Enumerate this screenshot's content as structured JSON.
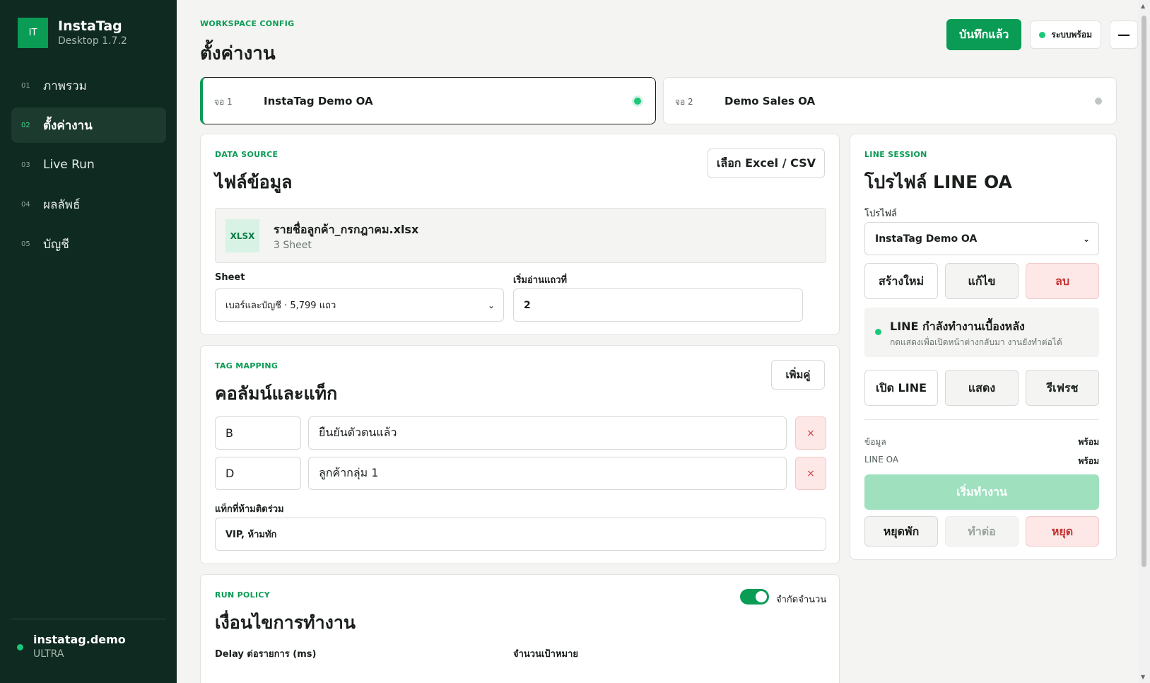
{
  "app": {
    "logo": "IT",
    "name": "InstaTag",
    "version": "Desktop 1.7.2"
  },
  "nav": [
    {
      "num": "01",
      "label": "ภาพรวม"
    },
    {
      "num": "02",
      "label": "ตั้งค่างาน"
    },
    {
      "num": "03",
      "label": "Live Run"
    },
    {
      "num": "04",
      "label": "ผลลัพธ์"
    },
    {
      "num": "05",
      "label": "บัญชี"
    }
  ],
  "user": {
    "name": "instatag.demo",
    "plan": "ULTRA"
  },
  "header": {
    "kicker": "WORKSPACE CONFIG",
    "title": "ตั้งค่างาน",
    "saved_label": "บันทึกแล้ว",
    "status_label": "ระบบพร้อม",
    "minimize_label": "—"
  },
  "screens": [
    {
      "num": "จอ 1",
      "name": "InstaTag Demo OA"
    },
    {
      "num": "จอ 2",
      "name": "Demo Sales OA"
    }
  ],
  "data_source": {
    "kicker": "DATA SOURCE",
    "title": "ไฟล์ข้อมูล",
    "choose_label": "เลือก Excel / CSV",
    "file_badge": "XLSX",
    "file_name": "รายชื่อลูกค้า_กรกฎาคม.xlsx",
    "file_meta": "3 Sheet",
    "sheet_label": "Sheet",
    "sheet_value": "เบอร์และบัญชี · 5,799 แถว",
    "start_row_label": "เริ่มอ่านแถวที่",
    "start_row_value": "2"
  },
  "tag_mapping": {
    "kicker": "TAG MAPPING",
    "title": "คอลัมน์และแท็ก",
    "add_label": "เพิ่มคู่",
    "rows": [
      {
        "column": "B",
        "tag": "ยืนยันตัวตนแล้ว"
      },
      {
        "column": "D",
        "tag": "ลูกค้ากลุ่ม 1"
      }
    ],
    "delete_glyph": "×",
    "excluded_label": "แท็กที่ห้ามติดร่วม",
    "excluded_value": "VIP, ห้ามทัก"
  },
  "run_policy": {
    "kicker": "RUN POLICY",
    "title": "เงื่อนไขการทำงาน",
    "limit_toggle_label": "จำกัดจำนวน",
    "delay_label": "Delay ต่อรายการ (ms)",
    "target_label": "จำนวนเป้าหมาย"
  },
  "line_session": {
    "kicker": "LINE SESSION",
    "title": "โปรไฟล์ LINE OA",
    "profile_label": "โปรไฟล์",
    "profile_value": "InstaTag Demo OA",
    "create_label": "สร้างใหม่",
    "edit_label": "แก้ไข",
    "delete_label": "ลบ",
    "status_title": "LINE กำลังทำงานเบื้องหลัง",
    "status_sub": "กดแสดงเพื่อเปิดหน้าต่างกลับมา งานยังทำต่อได้",
    "open_label": "เปิด LINE",
    "show_label": "แสดง",
    "refresh_label": "รีเฟรช",
    "data_key": "ข้อมูล",
    "data_value": "พร้อม",
    "oa_key": "LINE OA",
    "oa_value": "พร้อม",
    "start_label": "เริ่มทำงาน",
    "pause_label": "หยุดพัก",
    "resume_label": "ทำต่อ",
    "stop_label": "หยุด"
  },
  "colors": {
    "accent": "#0a9b55",
    "sidebar": "#0f2a20",
    "danger_bg": "#fde7e7"
  }
}
